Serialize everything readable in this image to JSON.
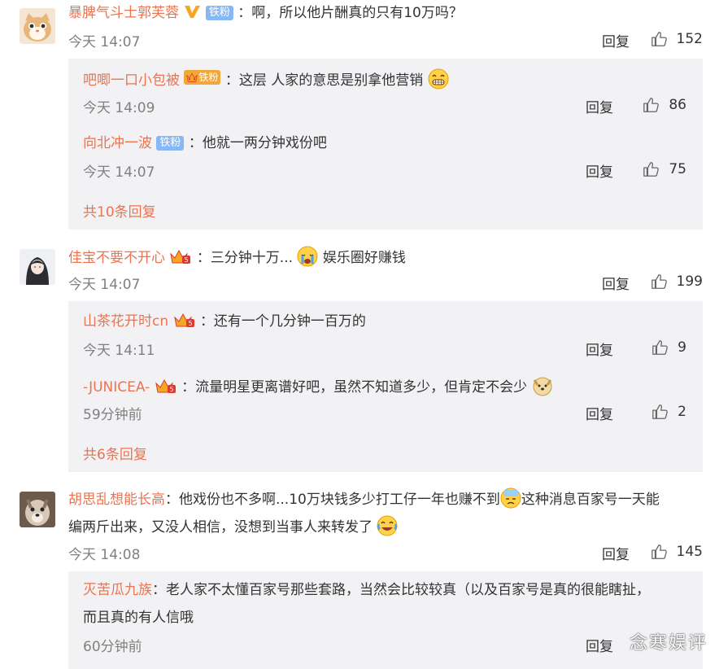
{
  "ui": {
    "reply_label": "回复"
  },
  "comments": [
    {
      "user": "暴脾气斗士郭芙蓉",
      "badge": "铁粉",
      "text": "：啊，所以他片酬真的只有10万吗？",
      "time": "今天 14:07",
      "likes": "152",
      "replies": [
        {
          "user": "吧唧一口小包被",
          "badge": "铁粉",
          "text": "：这层 人家的意思是别拿他营销",
          "time": "今天 14:09",
          "likes": "86"
        },
        {
          "user": "向北冲一波",
          "badge": "铁粉",
          "text": "：他就一两分钟戏份吧",
          "time": "今天 14:07",
          "likes": "75"
        }
      ],
      "more": "共10条回复"
    },
    {
      "user": "佳宝不要不开心",
      "text_a": "：三分钟十万...",
      "text_b": "娱乐圈好赚钱",
      "time": "今天 14:07",
      "likes": "199",
      "replies": [
        {
          "user": "山茶花开时cn",
          "text": "：还有一个几分钟一百万的",
          "time": "今天 14:11",
          "likes": "9"
        },
        {
          "user": "-JUNICEA-",
          "text": "：流量明星更离谱好吧，虽然不知道多少，但肯定不会少",
          "time": "59分钟前",
          "likes": "2"
        }
      ],
      "more": "共6条回复"
    },
    {
      "user": "胡思乱想能长高",
      "text_a": "：他戏份也不多啊...10万块钱多少打工仔一年也赚不到",
      "text_b": "这种消息百家号一天能",
      "text_c": "编两斤出来，又没人相信，没想到当事人来转发了",
      "time": "今天 14:08",
      "likes": "145",
      "replies": [
        {
          "user": "灭苦瓜九族",
          "text_a": "：老人家不太懂百家号那些套路，当然会比较较真（以及百家号是真的很能瞎扯，",
          "text_b": "而且真的有人信哦",
          "time": "60分钟前",
          "reply_partial": "回复"
        }
      ]
    }
  ],
  "watermark": "念寒娱评",
  "colors": {
    "username": "#eb7350",
    "reply_bg": "#f2f2f5",
    "iron_fan_badge": "#87b7f5",
    "crown_badge": "#f0a73b"
  }
}
